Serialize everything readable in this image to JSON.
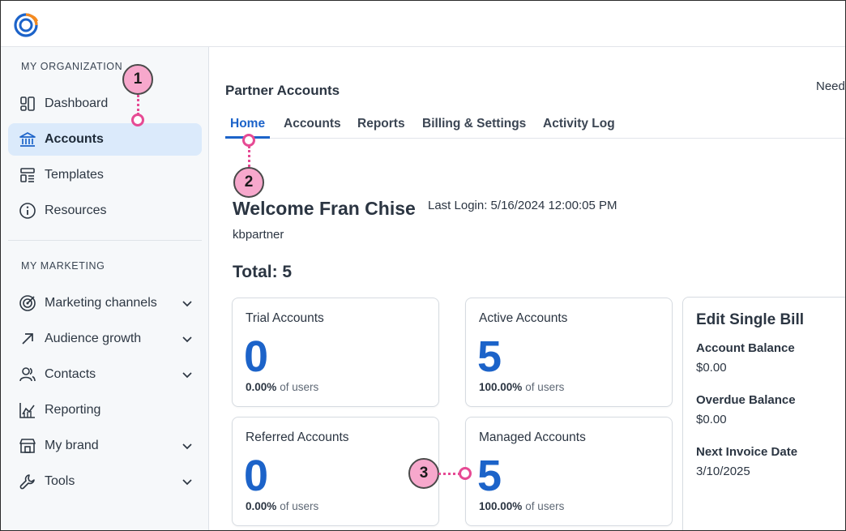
{
  "colors": {
    "accent": "#1c63c9",
    "active_nav_bg": "#dbeafb",
    "callout_fill": "#f7a8cc",
    "callout_line": "#e64a94"
  },
  "sidebar": {
    "section1": "MY ORGANIZATION",
    "section2": "MY MARKETING",
    "items": [
      {
        "label": "Dashboard",
        "icon": "dashboard-icon"
      },
      {
        "label": "Accounts",
        "icon": "bank-icon",
        "active": true
      },
      {
        "label": "Templates",
        "icon": "templates-icon"
      },
      {
        "label": "Resources",
        "icon": "info-icon"
      },
      {
        "label": "Marketing channels",
        "icon": "target-icon",
        "expandable": true
      },
      {
        "label": "Audience growth",
        "icon": "arrow-up-right-icon",
        "expandable": true
      },
      {
        "label": "Contacts",
        "icon": "contacts-icon",
        "expandable": true
      },
      {
        "label": "Reporting",
        "icon": "chart-icon"
      },
      {
        "label": "My brand",
        "icon": "store-icon",
        "expandable": true
      },
      {
        "label": "Tools",
        "icon": "wrench-icon",
        "expandable": true
      }
    ]
  },
  "header": {
    "page_title": "Partner Accounts",
    "need_help": "Need"
  },
  "tabs": [
    {
      "label": "Home",
      "active": true
    },
    {
      "label": "Accounts"
    },
    {
      "label": "Reports"
    },
    {
      "label": "Billing & Settings"
    },
    {
      "label": "Activity Log"
    }
  ],
  "welcome": {
    "greeting": "Welcome Fran Chise",
    "last_login": "Last Login: 5/16/2024 12:00:05 PM",
    "username": "kbpartner",
    "total": "Total: 5"
  },
  "cards": [
    {
      "title": "Trial Accounts",
      "value": "0",
      "pct": "0.00%",
      "of": "of users"
    },
    {
      "title": "Active Accounts",
      "value": "5",
      "pct": "100.00%",
      "of": "of users"
    },
    {
      "title": "Referred Accounts",
      "value": "0",
      "pct": "0.00%",
      "of": "of users"
    },
    {
      "title": "Managed Accounts",
      "value": "5",
      "pct": "100.00%",
      "of": "of users"
    }
  ],
  "billing": {
    "title": "Edit Single Bill",
    "account_balance_label": "Account Balance",
    "account_balance_value": "$0.00",
    "overdue_balance_label": "Overdue Balance",
    "overdue_balance_value": "$0.00",
    "next_invoice_label": "Next Invoice Date",
    "next_invoice_value": "3/10/2025"
  },
  "callouts": [
    "1",
    "2",
    "3"
  ]
}
